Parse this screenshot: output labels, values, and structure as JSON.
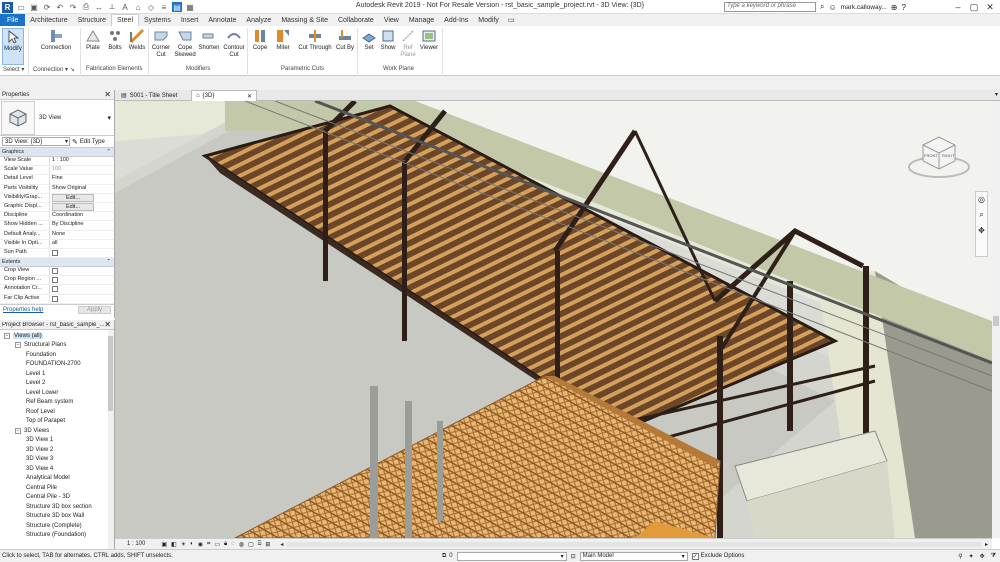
{
  "app": {
    "title": "Autodesk Revit 2019 - Not For Resale Version - rst_basic_sample_project.rvt - 3D View: {3D}",
    "search_placeholder": "Type a keyword or phrase",
    "user": "mark.calloway..."
  },
  "ribbon_tabs": [
    "File",
    "Architecture",
    "Structure",
    "Steel",
    "Systems",
    "Insert",
    "Annotate",
    "Analyze",
    "Massing & Site",
    "Collaborate",
    "View",
    "Manage",
    "Add-Ins",
    "Modify"
  ],
  "ribbon_active": "Steel",
  "tools": {
    "modify": "Modify",
    "connection": "Connection",
    "plate": "Plate",
    "bolts": "Bolts",
    "welds": "Welds",
    "corner_cut": "Corner\nCut",
    "cope_skewed": "Cope\nSkewed",
    "shorten": "Shorten",
    "contour_cut": "Contour\nCut",
    "cope": "Cope",
    "miter": "Miter",
    "cut_through": "Cut Through",
    "cut_by": "Cut By",
    "set": "Set",
    "show": "Show",
    "ref_plane": "Ref\nPlane",
    "viewer": "Viewer"
  },
  "panels": {
    "select": "Select",
    "connection": "Connection",
    "fabrication": "Fabrication Elements",
    "modifiers": "Modifiers",
    "parametric": "Parametric Cuts",
    "workplane": "Work Plane"
  },
  "doc_tabs": [
    {
      "label": "S001 - Title Sheet"
    },
    {
      "label": "{3D}"
    }
  ],
  "properties": {
    "title": "Properties",
    "type_name": "3D View",
    "view_selector": "3D View: {3D}",
    "edit_type": "Edit Type",
    "cat_graphics": "Graphics",
    "rows": [
      {
        "k": "View Scale",
        "v": "1 : 100"
      },
      {
        "k": "Scale Value",
        "v": "100"
      },
      {
        "k": "Detail Level",
        "v": "Fine"
      },
      {
        "k": "Parts Visibility",
        "v": "Show Original"
      },
      {
        "k": "Visibility/Grap...",
        "v": "Edit..."
      },
      {
        "k": "Graphic Displ...",
        "v": "Edit..."
      },
      {
        "k": "Discipline",
        "v": "Coordination"
      },
      {
        "k": "Show Hidden ...",
        "v": "By Discipline"
      },
      {
        "k": "Default Analy...",
        "v": "None"
      },
      {
        "k": "Visible In Opti...",
        "v": "all"
      },
      {
        "k": "Sun Path",
        "v": ""
      }
    ],
    "cat_extents": "Extents",
    "extent_rows": [
      {
        "k": "Crop View",
        "v": ""
      },
      {
        "k": "Crop Region ...",
        "v": ""
      },
      {
        "k": "Annotation Cr...",
        "v": ""
      },
      {
        "k": "Far Clip Active",
        "v": ""
      }
    ],
    "help": "Properties help",
    "apply": "Apply"
  },
  "browser": {
    "title": "Project Browser - rst_basic_sample_...",
    "items": [
      {
        "label": "Views (all)",
        "level": 0
      },
      {
        "label": "Structural Plans",
        "level": 1
      },
      {
        "label": "Foundation",
        "level": 2
      },
      {
        "label": "FOUNDATION-2700",
        "level": 2
      },
      {
        "label": "Level 1",
        "level": 2
      },
      {
        "label": "Level 2",
        "level": 2
      },
      {
        "label": "Level Lower",
        "level": 2
      },
      {
        "label": "Ref Beam system",
        "level": 2
      },
      {
        "label": "Roof Level",
        "level": 2
      },
      {
        "label": "Top of Parapet",
        "level": 2
      },
      {
        "label": "3D Views",
        "level": 1
      },
      {
        "label": "3D View 1",
        "level": 2
      },
      {
        "label": "3D View 2",
        "level": 2
      },
      {
        "label": "3D View 3",
        "level": 2
      },
      {
        "label": "3D View 4",
        "level": 2
      },
      {
        "label": "Analytical Model",
        "level": 2
      },
      {
        "label": "Central Pile",
        "level": 2
      },
      {
        "label": "Central Pile - 3D",
        "level": 2
      },
      {
        "label": "Structure 3D box section",
        "level": 2
      },
      {
        "label": "Structure 3D box Wall",
        "level": 2
      },
      {
        "label": "Structure (Complete)",
        "level": 2
      },
      {
        "label": "Structure (Foundation)",
        "level": 2
      }
    ]
  },
  "viewcube": {
    "front": "FRONT",
    "right": "RIGHT"
  },
  "view_controls": {
    "scale": "1 : 100"
  },
  "status": {
    "message": "Click to select, TAB for alternates, CTRL adds, SHIFT unselects.",
    "workset_value": "0",
    "model": "Main Model",
    "exclude_options": "Exclude Options"
  },
  "colors": {
    "accent": "#1a73c9",
    "steel": "#3a2a22",
    "timber": "#c9883a",
    "wall": "#d6d8c4"
  }
}
